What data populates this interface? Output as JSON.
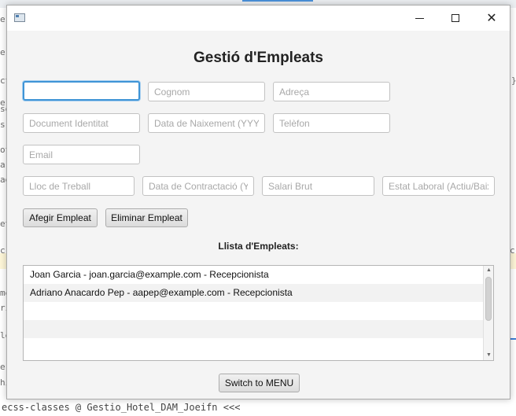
{
  "background": {
    "code_fragments": [
      "e",
      "e",
      "ct",
      "e",
      "se",
      "s",
      "ot",
      "ar",
      "ag",
      "et",
      "c",
      "c",
      "me",
      "ri",
      "le",
      "e",
      "hi",
      "}"
    ],
    "bottom_text": "ecss-classes @ Gestio_Hotel_DAM_Joeifn <<<"
  },
  "window": {
    "controls": {
      "minimize_icon": "minimize-icon",
      "maximize_icon": "maximize-icon",
      "close_icon": "close-icon",
      "close_glyph": "✕"
    }
  },
  "form": {
    "title": "Gestió d'Empleats",
    "fields": {
      "nom": {
        "value": "",
        "placeholder": ""
      },
      "cognom": {
        "value": "",
        "placeholder": "Cognom"
      },
      "adreca": {
        "value": "",
        "placeholder": "Adreça"
      },
      "document": {
        "value": "",
        "placeholder": "Document Identitat"
      },
      "naixement": {
        "value": "",
        "placeholder": "Data de Naixement (YYYY"
      },
      "telefon": {
        "value": "",
        "placeholder": "Telèfon"
      },
      "email": {
        "value": "",
        "placeholder": "Email"
      },
      "lloc_treball": {
        "value": "",
        "placeholder": "Lloc de Treball"
      },
      "contractacio": {
        "value": "",
        "placeholder": "Data de Contractació (Y"
      },
      "salari": {
        "value": "",
        "placeholder": "Salari Brut"
      },
      "estat": {
        "value": "",
        "placeholder": "Estat Laboral (Actiu/Baix"
      }
    },
    "buttons": {
      "add_label": "Afegir Empleat",
      "delete_label": "Eliminar Empleat",
      "switch_label": "Switch to MENU"
    }
  },
  "list": {
    "title": "Llista d'Empleats:",
    "items": [
      "Joan Garcia - joan.garcia@example.com - Recepcionista",
      "Adriano Anacardo Pep - aapep@example.com - Recepcionista",
      "",
      "",
      ""
    ]
  }
}
